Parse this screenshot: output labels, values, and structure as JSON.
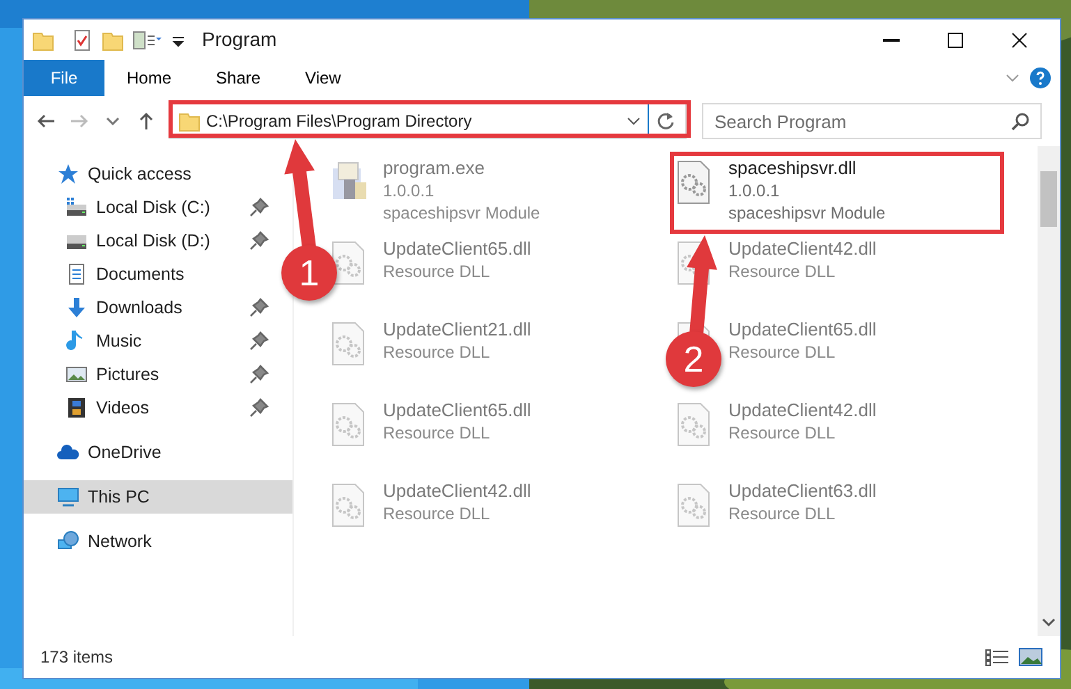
{
  "window": {
    "title": "Program"
  },
  "ribbon_tabs": [
    {
      "label": "File",
      "kind": "file"
    },
    {
      "label": "Home",
      "kind": "tab"
    },
    {
      "label": "Share",
      "kind": "tab"
    },
    {
      "label": "View",
      "kind": "tab"
    }
  ],
  "address_bar": {
    "path": "C:\\Program Files\\Program Directory"
  },
  "search": {
    "placeholder": "Search Program"
  },
  "navigation": [
    {
      "label": "Quick access",
      "kind": "quick",
      "selected": false,
      "children": [
        {
          "label": "Local Disk (C:)",
          "kind": "disk-c",
          "pinned": true
        },
        {
          "label": "Local Disk (D:)",
          "kind": "disk",
          "pinned": true
        },
        {
          "label": "Documents",
          "kind": "documents"
        },
        {
          "label": "Downloads",
          "kind": "downloads",
          "pinned": true
        },
        {
          "label": "Music",
          "kind": "music",
          "pinned": true
        },
        {
          "label": "Pictures",
          "kind": "pictures",
          "pinned": true
        },
        {
          "label": "Videos",
          "kind": "videos",
          "pinned": true
        }
      ]
    },
    {
      "label": "OneDrive",
      "kind": "cloud",
      "selected": false
    },
    {
      "label": "This PC",
      "kind": "pc",
      "selected": true
    },
    {
      "label": "Network",
      "kind": "network",
      "selected": false
    }
  ],
  "files": [
    {
      "name": "program.exe",
      "kind": "exe",
      "details": [
        "1.0.0.1",
        "spaceshipsvr Module"
      ],
      "faded": true
    },
    {
      "name": "spaceshipsvr.dll",
      "kind": "dll",
      "details": [
        "1.0.0.1",
        "spaceshipsvr Module"
      ],
      "faded": false
    },
    {
      "name": "UpdateClient65.dll",
      "kind": "dll",
      "details": [
        "Resource DLL"
      ],
      "faded": true
    },
    {
      "name": "UpdateClient42.dll",
      "kind": "dll",
      "details": [
        "Resource DLL"
      ],
      "faded": true
    },
    {
      "name": "UpdateClient21.dll",
      "kind": "dll",
      "details": [
        "Resource DLL"
      ],
      "faded": true
    },
    {
      "name": "UpdateClient65.dll",
      "kind": "dll",
      "details": [
        "Resource DLL"
      ],
      "faded": true
    },
    {
      "name": "UpdateClient65.dll",
      "kind": "dll",
      "details": [
        "Resource DLL"
      ],
      "faded": true
    },
    {
      "name": "UpdateClient42.dll",
      "kind": "dll",
      "details": [
        "Resource DLL"
      ],
      "faded": true
    },
    {
      "name": "UpdateClient42.dll",
      "kind": "dll",
      "details": [
        "Resource DLL"
      ],
      "faded": true
    },
    {
      "name": "UpdateClient63.dll",
      "kind": "dll",
      "details": [
        "Resource DLL"
      ],
      "faded": true
    }
  ],
  "status_bar": {
    "item_count": "173 items"
  },
  "annotations": [
    {
      "label": "1"
    },
    {
      "label": "2"
    }
  ]
}
